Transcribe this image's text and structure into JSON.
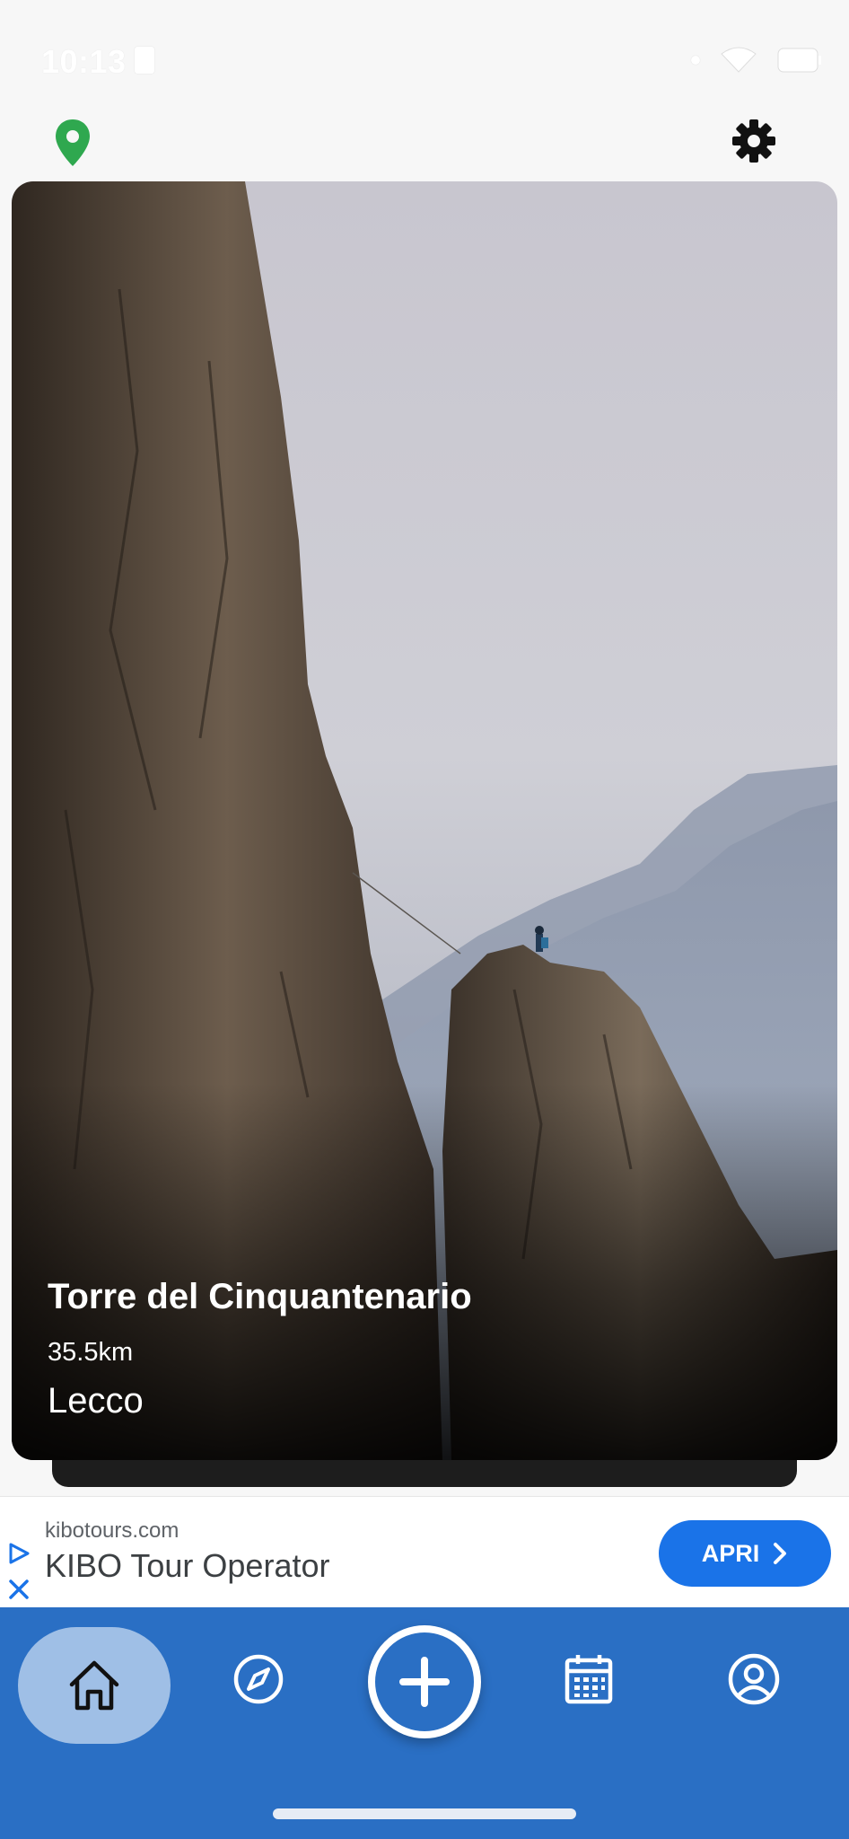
{
  "status_bar": {
    "time": "10:13"
  },
  "header": {
    "location_icon": "location-pin-icon",
    "settings_icon": "gear-icon",
    "location_color": "#2fa84f"
  },
  "card": {
    "title": "Torre del Cinquantenario",
    "distance": "35.5km",
    "city": "Lecco"
  },
  "ad": {
    "domain": "kibotours.com",
    "name": "KIBO Tour Operator",
    "cta_label": "APRI"
  },
  "nav": {
    "accent": "#2a6fc4",
    "items": [
      {
        "name": "home",
        "icon": "home-icon",
        "active": true
      },
      {
        "name": "explore",
        "icon": "compass-icon",
        "active": false
      },
      {
        "name": "add",
        "icon": "plus-icon",
        "active": false
      },
      {
        "name": "calendar",
        "icon": "calendar-icon",
        "active": false
      },
      {
        "name": "profile",
        "icon": "profile-icon",
        "active": false
      }
    ]
  }
}
